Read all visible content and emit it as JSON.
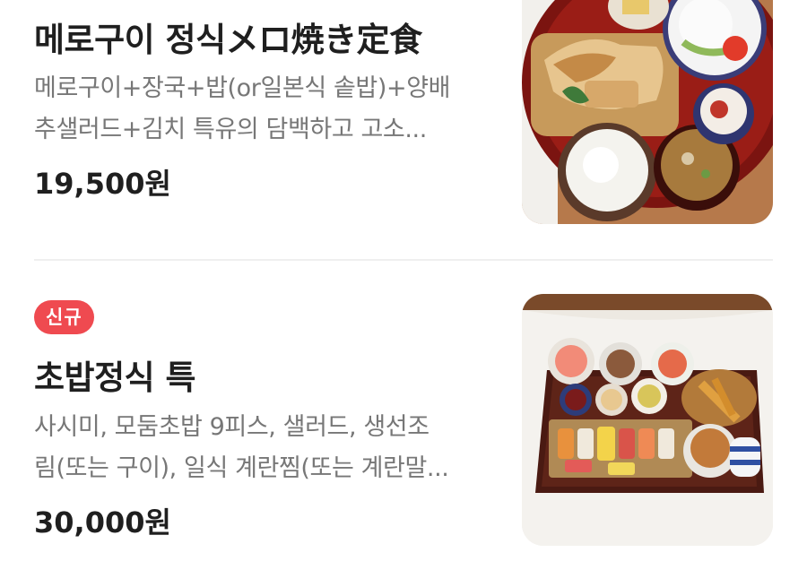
{
  "menu": [
    {
      "title": "메로구이 정식メロ焼き定食",
      "description_lines": [
        "메로구이+장국+밥(or일본식 솥밥)+양배",
        "추샐러드+김치 특유의 담백하고 고소..."
      ],
      "price": "19,500원",
      "badge": null,
      "image_icon": "grilled-fish-set-meal-photo"
    },
    {
      "badge": "신규",
      "title": "초밥정식 특",
      "description_lines": [
        "사시미, 모둠초밥 9피스, 샐러드, 생선조",
        "림(또는 구이), 일식 계란찜(또는 계란말..."
      ],
      "price": "30,000원",
      "image_icon": "sushi-set-meal-photo"
    }
  ],
  "colors": {
    "badge_bg": "#ef4a50",
    "title": "#1f1f1f",
    "description": "#777777",
    "divider": "#efefef"
  }
}
